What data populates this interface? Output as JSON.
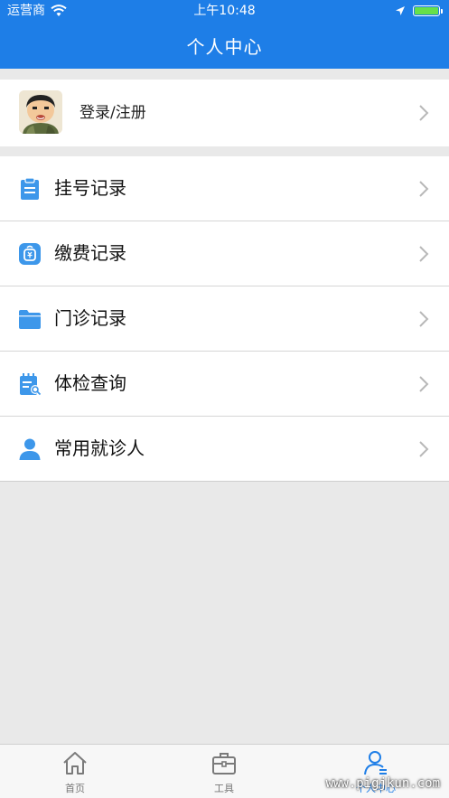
{
  "status_bar": {
    "carrier": "运营商",
    "time": "上午10:48"
  },
  "header": {
    "title": "个人中心"
  },
  "profile": {
    "label": "登录/注册"
  },
  "menu": {
    "items": [
      {
        "label": "挂号记录",
        "icon": "clipboard-icon"
      },
      {
        "label": "缴费记录",
        "icon": "payment-icon"
      },
      {
        "label": "门诊记录",
        "icon": "folder-icon"
      },
      {
        "label": "体检查询",
        "icon": "calendar-search-icon"
      },
      {
        "label": "常用就诊人",
        "icon": "person-icon"
      }
    ]
  },
  "tabbar": {
    "tabs": [
      {
        "label": "首页",
        "icon": "home-icon"
      },
      {
        "label": "工具",
        "icon": "toolbox-icon"
      },
      {
        "label": "个人中心",
        "icon": "user-icon"
      }
    ],
    "active_index": 2
  },
  "watermark": "www.pigjkun.com",
  "colors": {
    "primary": "#1e7ee7",
    "icon_blue": "#3d97ea",
    "background": "#e9e9e9",
    "battery_green": "#66e04a"
  }
}
